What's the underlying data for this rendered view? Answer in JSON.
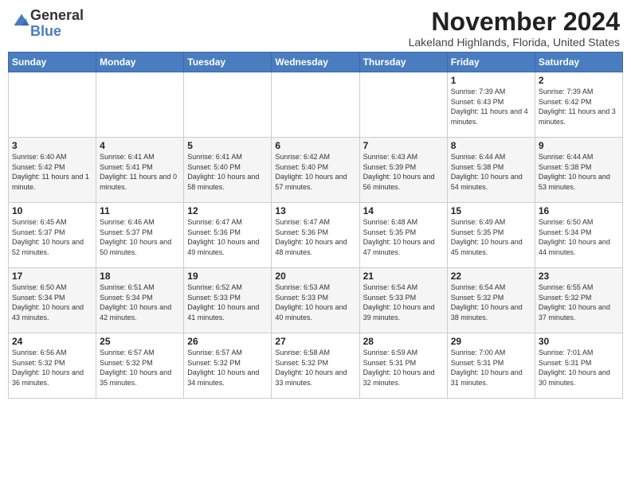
{
  "logo": {
    "general": "General",
    "blue": "Blue"
  },
  "header": {
    "month": "November 2024",
    "location": "Lakeland Highlands, Florida, United States"
  },
  "days_of_week": [
    "Sunday",
    "Monday",
    "Tuesday",
    "Wednesday",
    "Thursday",
    "Friday",
    "Saturday"
  ],
  "weeks": [
    [
      {
        "day": "",
        "info": ""
      },
      {
        "day": "",
        "info": ""
      },
      {
        "day": "",
        "info": ""
      },
      {
        "day": "",
        "info": ""
      },
      {
        "day": "",
        "info": ""
      },
      {
        "day": "1",
        "info": "Sunrise: 7:39 AM\nSunset: 6:43 PM\nDaylight: 11 hours and 4 minutes."
      },
      {
        "day": "2",
        "info": "Sunrise: 7:39 AM\nSunset: 6:42 PM\nDaylight: 11 hours and 3 minutes."
      }
    ],
    [
      {
        "day": "3",
        "info": "Sunrise: 6:40 AM\nSunset: 5:42 PM\nDaylight: 11 hours and 1 minute."
      },
      {
        "day": "4",
        "info": "Sunrise: 6:41 AM\nSunset: 5:41 PM\nDaylight: 11 hours and 0 minutes."
      },
      {
        "day": "5",
        "info": "Sunrise: 6:41 AM\nSunset: 5:40 PM\nDaylight: 10 hours and 58 minutes."
      },
      {
        "day": "6",
        "info": "Sunrise: 6:42 AM\nSunset: 5:40 PM\nDaylight: 10 hours and 57 minutes."
      },
      {
        "day": "7",
        "info": "Sunrise: 6:43 AM\nSunset: 5:39 PM\nDaylight: 10 hours and 56 minutes."
      },
      {
        "day": "8",
        "info": "Sunrise: 6:44 AM\nSunset: 5:38 PM\nDaylight: 10 hours and 54 minutes."
      },
      {
        "day": "9",
        "info": "Sunrise: 6:44 AM\nSunset: 5:38 PM\nDaylight: 10 hours and 53 minutes."
      }
    ],
    [
      {
        "day": "10",
        "info": "Sunrise: 6:45 AM\nSunset: 5:37 PM\nDaylight: 10 hours and 52 minutes."
      },
      {
        "day": "11",
        "info": "Sunrise: 6:46 AM\nSunset: 5:37 PM\nDaylight: 10 hours and 50 minutes."
      },
      {
        "day": "12",
        "info": "Sunrise: 6:47 AM\nSunset: 5:36 PM\nDaylight: 10 hours and 49 minutes."
      },
      {
        "day": "13",
        "info": "Sunrise: 6:47 AM\nSunset: 5:36 PM\nDaylight: 10 hours and 48 minutes."
      },
      {
        "day": "14",
        "info": "Sunrise: 6:48 AM\nSunset: 5:35 PM\nDaylight: 10 hours and 47 minutes."
      },
      {
        "day": "15",
        "info": "Sunrise: 6:49 AM\nSunset: 5:35 PM\nDaylight: 10 hours and 45 minutes."
      },
      {
        "day": "16",
        "info": "Sunrise: 6:50 AM\nSunset: 5:34 PM\nDaylight: 10 hours and 44 minutes."
      }
    ],
    [
      {
        "day": "17",
        "info": "Sunrise: 6:50 AM\nSunset: 5:34 PM\nDaylight: 10 hours and 43 minutes."
      },
      {
        "day": "18",
        "info": "Sunrise: 6:51 AM\nSunset: 5:34 PM\nDaylight: 10 hours and 42 minutes."
      },
      {
        "day": "19",
        "info": "Sunrise: 6:52 AM\nSunset: 5:33 PM\nDaylight: 10 hours and 41 minutes."
      },
      {
        "day": "20",
        "info": "Sunrise: 6:53 AM\nSunset: 5:33 PM\nDaylight: 10 hours and 40 minutes."
      },
      {
        "day": "21",
        "info": "Sunrise: 6:54 AM\nSunset: 5:33 PM\nDaylight: 10 hours and 39 minutes."
      },
      {
        "day": "22",
        "info": "Sunrise: 6:54 AM\nSunset: 5:32 PM\nDaylight: 10 hours and 38 minutes."
      },
      {
        "day": "23",
        "info": "Sunrise: 6:55 AM\nSunset: 5:32 PM\nDaylight: 10 hours and 37 minutes."
      }
    ],
    [
      {
        "day": "24",
        "info": "Sunrise: 6:56 AM\nSunset: 5:32 PM\nDaylight: 10 hours and 36 minutes."
      },
      {
        "day": "25",
        "info": "Sunrise: 6:57 AM\nSunset: 5:32 PM\nDaylight: 10 hours and 35 minutes."
      },
      {
        "day": "26",
        "info": "Sunrise: 6:57 AM\nSunset: 5:32 PM\nDaylight: 10 hours and 34 minutes."
      },
      {
        "day": "27",
        "info": "Sunrise: 6:58 AM\nSunset: 5:32 PM\nDaylight: 10 hours and 33 minutes."
      },
      {
        "day": "28",
        "info": "Sunrise: 6:59 AM\nSunset: 5:31 PM\nDaylight: 10 hours and 32 minutes."
      },
      {
        "day": "29",
        "info": "Sunrise: 7:00 AM\nSunset: 5:31 PM\nDaylight: 10 hours and 31 minutes."
      },
      {
        "day": "30",
        "info": "Sunrise: 7:01 AM\nSunset: 5:31 PM\nDaylight: 10 hours and 30 minutes."
      }
    ]
  ]
}
